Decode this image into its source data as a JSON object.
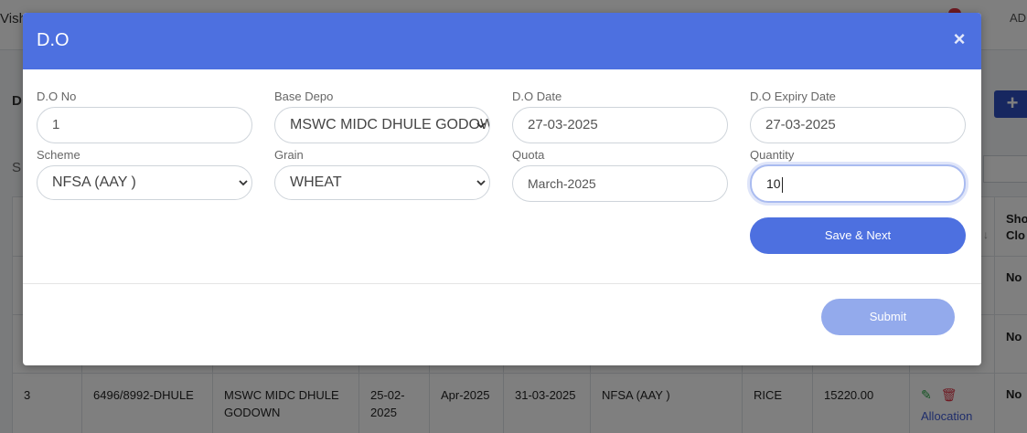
{
  "background": {
    "user_name": "Vish",
    "admin_label": "AD",
    "page_title": "D",
    "search_label": "S",
    "add_symbol": "+",
    "short_close_header": "Sho\nClo",
    "rows": [
      {
        "short_closed": "No"
      },
      {
        "short_closed": "No"
      },
      {
        "index": "3",
        "do_no": "6496/8992-DHULE",
        "depo": "MSWC MIDC DHULE GODOWN",
        "do_date": "25-02-2025",
        "quota": "Apr-2025",
        "expiry": "31-03-2025",
        "scheme": "NFSA (AAY )",
        "grain": "RICE",
        "quantity": "15220.00",
        "action_link": "Allocation",
        "short_closed": "No"
      }
    ]
  },
  "modal": {
    "title": "D.O",
    "close_symbol": "×",
    "fields": {
      "do_no": {
        "label": "D.O No",
        "value": "1"
      },
      "base_depo": {
        "label": "Base Depo",
        "value": "MSWC MIDC DHULE GODOWN"
      },
      "do_date": {
        "label": "D.O Date",
        "value": "27-03-2025"
      },
      "do_expiry_date": {
        "label": "D.O Expiry Date",
        "value": "27-03-2025"
      },
      "scheme": {
        "label": "Scheme",
        "value": "NFSA (AAY )"
      },
      "grain": {
        "label": "Grain",
        "value": "WHEAT"
      },
      "quota": {
        "label": "Quota",
        "value": "March-2025"
      },
      "quantity": {
        "label": "Quantity",
        "value": "10"
      }
    },
    "save_next_label": "Save & Next",
    "submit_label": "Submit"
  },
  "colors": {
    "header": "#4d70e0",
    "primary_button": "#4d70e0",
    "submit_disabled": "#93aaec"
  }
}
